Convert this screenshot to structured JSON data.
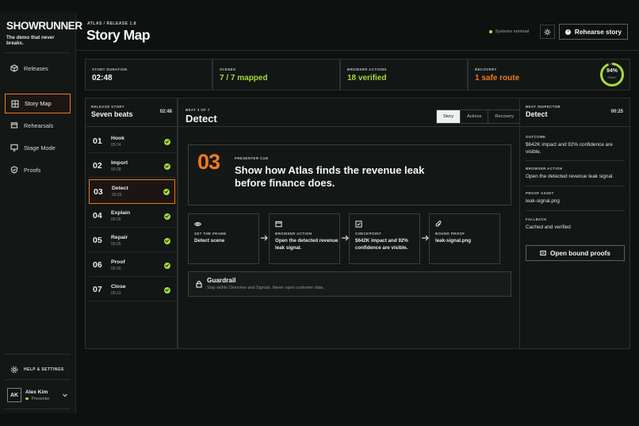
{
  "brand": {
    "name": "SHOWRUNNER",
    "tagline": "The demo that never breaks."
  },
  "nav": [
    {
      "label": "Releases",
      "icon": "cube-icon"
    },
    {
      "label": "Story Map",
      "icon": "grid-icon",
      "active": true
    },
    {
      "label": "Rehearsals",
      "icon": "layers-icon"
    },
    {
      "label": "Stage Mode",
      "icon": "monitor-icon"
    },
    {
      "label": "Proofs",
      "icon": "shield-icon"
    }
  ],
  "help": {
    "label": "HELP & SETTINGS"
  },
  "user": {
    "initials": "AK",
    "name": "Alex Kim",
    "role": "Presenter"
  },
  "header": {
    "breadcrumb": "ATLAS / RELEASE 1.8",
    "title": "Story Map",
    "status": "Systems nominal",
    "rehearse_label": "Rehearse story"
  },
  "stats": [
    {
      "label": "STORY DURATION",
      "value": "02:48",
      "color": "#f4f6f4"
    },
    {
      "label": "SCENES",
      "value": "7 / 7 mapped",
      "color": "#a6d93d"
    },
    {
      "label": "BROWSER ACTIONS",
      "value": "18 verified",
      "color": "#a6d93d"
    },
    {
      "label": "RECOVERY",
      "value": "1 safe route",
      "color": "#f07a1a"
    }
  ],
  "readiness": {
    "percent": 94,
    "label": "94%",
    "sub": "READY"
  },
  "story": {
    "label": "RELEASE STORY",
    "title": "Seven beats",
    "duration": "02:48",
    "beats": [
      {
        "num": "01",
        "title": "Hook",
        "time": "00:24"
      },
      {
        "num": "02",
        "title": "Import",
        "time": "00:28"
      },
      {
        "num": "03",
        "title": "Detect",
        "time": "00:25",
        "active": true
      },
      {
        "num": "04",
        "title": "Explain",
        "time": "00:26"
      },
      {
        "num": "05",
        "title": "Repair",
        "time": "00:25"
      },
      {
        "num": "06",
        "title": "Proof",
        "time": "00:26"
      },
      {
        "num": "07",
        "title": "Close",
        "time": "00:13"
      }
    ]
  },
  "beat": {
    "label": "BEAT 3 OF 7",
    "title": "Detect",
    "tabs": [
      "Story",
      "Actions",
      "Recovery"
    ],
    "active_tab": "Story",
    "cue_num": "03",
    "cue_label": "PRESENTER CUE",
    "cue_text": "Show how Atlas finds the revenue leak before finance does.",
    "steps": [
      {
        "label": "SET THE FRAME",
        "text": "Detect scene",
        "icon": "eye-icon"
      },
      {
        "label": "BROWSER ACTION",
        "text": "Open the detected revenue leak signal.",
        "icon": "browser-icon"
      },
      {
        "label": "CHECKPOINT",
        "text": "$642K impact and 92% confidence are visible.",
        "icon": "checkbox-icon"
      },
      {
        "label": "BOUND PROOF",
        "text": "leak-signal.png",
        "icon": "paperclip-icon"
      }
    ],
    "guardrail_title": "Guardrail",
    "guardrail_text": "Stay within Overview and Signals. Never open customer data."
  },
  "inspector": {
    "label": "BEAT INSPECTOR",
    "title": "Detect",
    "time": "00:25",
    "sections": [
      {
        "label": "OUTCOME",
        "value": "$642K impact and 92% confidence are visible."
      },
      {
        "label": "BROWSER ACTION",
        "value": "Open the detected revenue leak signal."
      },
      {
        "label": "PROOF ASSET",
        "value": "leak-signal.png"
      },
      {
        "label": "FALLBACK",
        "value": "Cached and verified"
      }
    ],
    "button": "Open bound proofs"
  }
}
